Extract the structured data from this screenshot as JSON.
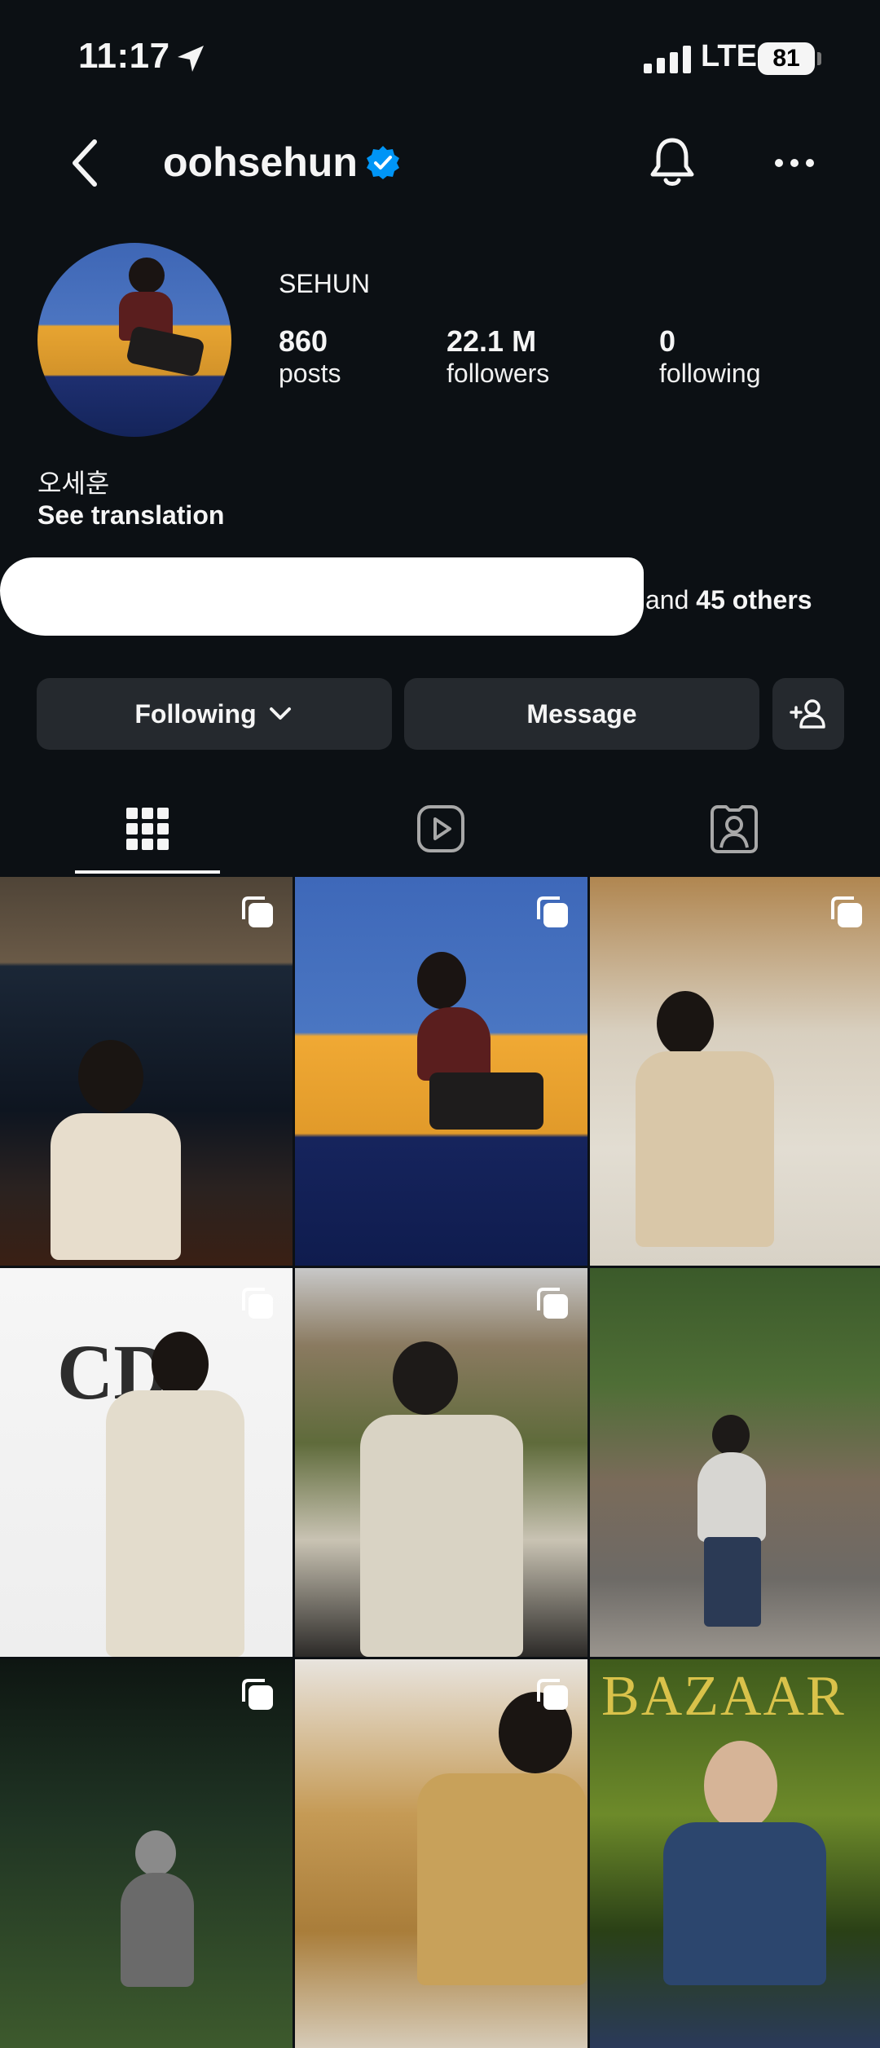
{
  "status_bar": {
    "time": "11:17",
    "network": "LTE",
    "battery": "81"
  },
  "header": {
    "username": "oohsehun"
  },
  "profile": {
    "display_name": "SEHUN",
    "stats": [
      {
        "value": "860",
        "label": "posts"
      },
      {
        "value": "22.1 M",
        "label": "followers"
      },
      {
        "value": "0",
        "label": "following"
      }
    ],
    "bio": "오세훈",
    "see_translation": "See translation",
    "followed_by_prefix": "and ",
    "followed_by_count": "45 others"
  },
  "actions": {
    "following_label": "Following",
    "message_label": "Message"
  },
  "colors": {
    "background": "#0c1014",
    "button": "#25292e",
    "verified": "#0095f6"
  },
  "grid": {
    "tiles": [
      "post-1",
      "post-2",
      "post-3",
      "post-4",
      "post-5",
      "post-6",
      "post-7",
      "post-8",
      "post-9"
    ]
  },
  "magazine_text": {
    "bazaar": "BAZAAR",
    "dior": "CD"
  }
}
